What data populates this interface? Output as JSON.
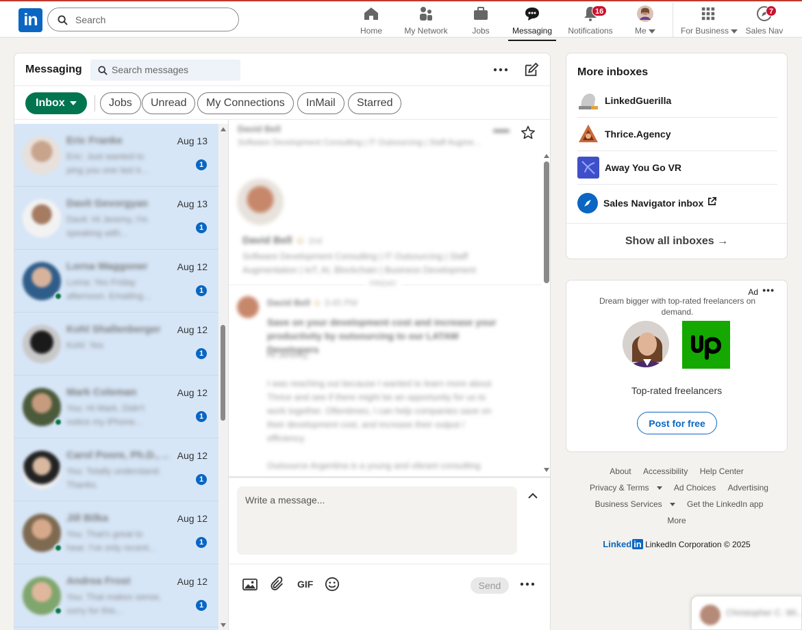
{
  "nav": {
    "logo": "in",
    "search_placeholder": "Search",
    "items": [
      {
        "label": "Home"
      },
      {
        "label": "My Network"
      },
      {
        "label": "Jobs"
      },
      {
        "label": "Messaging"
      },
      {
        "label": "Notifications",
        "badge": "16"
      },
      {
        "label": "Me"
      },
      {
        "label": "For Business"
      },
      {
        "label": "Sales Nav",
        "badge": "7"
      }
    ]
  },
  "messaging": {
    "title": "Messaging",
    "search_placeholder": "Search messages",
    "filters": [
      "Inbox",
      "Jobs",
      "Unread",
      "My Connections",
      "InMail",
      "Starred"
    ],
    "conversations": [
      {
        "name": "Eric Franke",
        "snippet": "Eric: Just wanted to ping you one last ti...",
        "date": "Aug 13",
        "unread": "1"
      },
      {
        "name": "Davit Gevorgyan",
        "snippet": "Davit: Hi Jeremy, I'm speaking with...",
        "date": "Aug 13",
        "unread": "1"
      },
      {
        "name": "Lorna Waggoner",
        "snippet": "Lorna: Yes Friday afternoon. Emailing...",
        "date": "Aug 12",
        "unread": "1"
      },
      {
        "name": "Kohl Shallenberger",
        "snippet": "Kohl: Yes",
        "date": "Aug 12",
        "unread": "1"
      },
      {
        "name": "Mark Coleman",
        "snippet": "You: Hi Mark, Didn't notice my iPhone...",
        "date": "Aug 12",
        "unread": "1"
      },
      {
        "name": "Carol Poore, Ph.D., ...",
        "snippet": "You: Totally understand. Thanks.",
        "date": "Aug 12",
        "unread": "1"
      },
      {
        "name": "Jill Bilka",
        "snippet": "You: That's great to hear. I've only recent...",
        "date": "Aug 12",
        "unread": "1"
      },
      {
        "name": "Andrea Frost",
        "snippet": "You: That makes sense, sorry for this...",
        "date": "Aug 12",
        "unread": "1"
      }
    ],
    "thread": {
      "name": "David Bell",
      "headline": "Software Development Consulting | IT Outsourcing | Staff Augme...",
      "degree": "2nd",
      "full_headline": "Software Development Consulting | IT Outsourcing | Staff Augmentation | IoT, AI, Blockchain | Business Development",
      "day": "FRIDAY",
      "time": "3:45 PM",
      "subject": "Save on your development cost and increase your productivity by outsourcing to our LATAM Developers",
      "greeting": "Hi Jeremy,",
      "body1": "I was reaching out because I wanted to learn more about Thrice and see if there might be an opportunity for us to work together. Oftentimes, I can help companies save on their development cost, and increase their output / efficiency.",
      "body2": "Outsource Argentina is a young and vibrant consulting"
    },
    "compose_placeholder": "Write a message...",
    "gif_label": "GIF",
    "send_label": "Send"
  },
  "inboxes": {
    "title": "More inboxes",
    "items": [
      {
        "name": "LinkedGuerilla"
      },
      {
        "name": "Thrice.Agency"
      },
      {
        "name": "Away You Go VR"
      },
      {
        "name": "Sales Navigator inbox"
      }
    ],
    "show_all": "Show all inboxes"
  },
  "ad": {
    "label": "Ad",
    "text": "Dream bigger with top-rated freelancers on demand.",
    "headline": "Top-rated freelancers",
    "cta": "Post for free"
  },
  "footer": {
    "links": [
      "About",
      "Accessibility",
      "Help Center",
      "Privacy & Terms",
      "Ad Choices",
      "Advertising",
      "Business Services",
      "Get the LinkedIn app",
      "More"
    ],
    "brand_word": "Linked",
    "brand_in": "in",
    "copyright": "LinkedIn Corporation © 2025"
  },
  "mini_chat": {
    "name": "Christopher C. Wi..."
  },
  "colors": {
    "brand": "#0a66c2",
    "inbox_green": "#01754f",
    "unread_blue": "#0a66c2",
    "notification_red": "#cb112d",
    "list_highlight": "#d7e6f7",
    "upwork_green": "#14a800"
  }
}
